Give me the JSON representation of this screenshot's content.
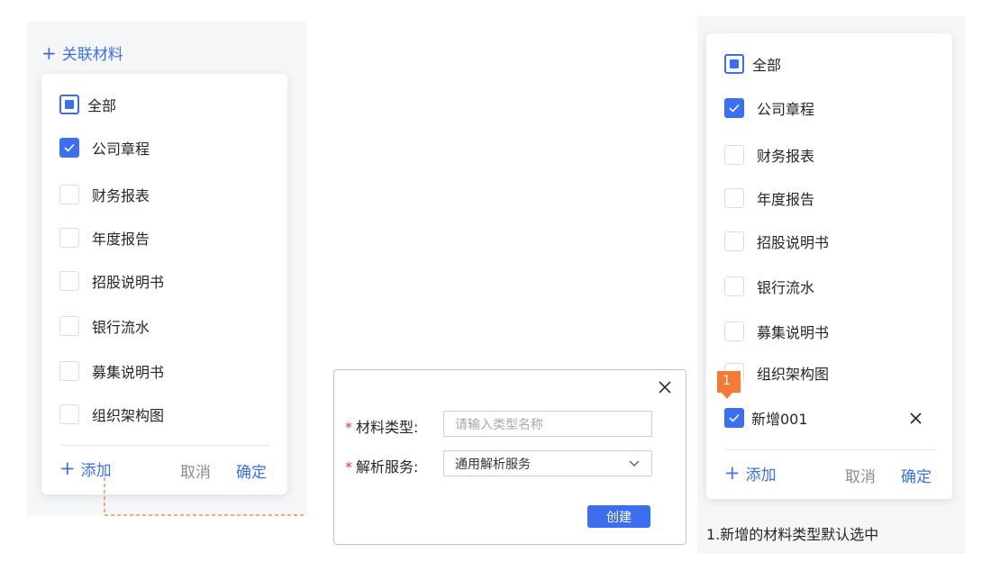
{
  "left_panel": {
    "header_label": "关联材料",
    "header_plus": "+",
    "items": [
      {
        "label": "全部",
        "state": "indeterminate"
      },
      {
        "label": "公司章程",
        "state": "checked"
      },
      {
        "label": "财务报表",
        "state": "unchecked"
      },
      {
        "label": "年度报告",
        "state": "unchecked"
      },
      {
        "label": "招股说明书",
        "state": "unchecked"
      },
      {
        "label": "银行流水",
        "state": "unchecked"
      },
      {
        "label": "募集说明书",
        "state": "unchecked"
      },
      {
        "label": "组织架构图",
        "state": "unchecked"
      }
    ],
    "add_plus": "+",
    "add_label": "添加",
    "cancel_label": "取消",
    "confirm_label": "确定"
  },
  "dialog": {
    "close_icon": "close-icon",
    "required_mark": "*",
    "type_label": "材料类型:",
    "type_placeholder": "请输入类型名称",
    "service_label": "解析服务:",
    "service_value": "通用解析服务",
    "create_label": "创建"
  },
  "right_panel": {
    "items": [
      {
        "label": "全部",
        "state": "indeterminate"
      },
      {
        "label": "公司章程",
        "state": "checked"
      },
      {
        "label": "财务报表",
        "state": "unchecked"
      },
      {
        "label": "年度报告",
        "state": "unchecked"
      },
      {
        "label": "招股说明书",
        "state": "unchecked"
      },
      {
        "label": "银行流水",
        "state": "unchecked"
      },
      {
        "label": "募集说明书",
        "state": "unchecked"
      },
      {
        "label": "组织架构图",
        "state": "unchecked"
      }
    ],
    "new_item_label": "新增001",
    "new_item_state": "checked",
    "badge_number": "1",
    "add_plus": "+",
    "add_label": "添加",
    "cancel_label": "取消",
    "confirm_label": "确定",
    "note": "1.新增的材料类型默认选中"
  },
  "colors": {
    "accent": "#3c6ff0",
    "badge": "#f37a37",
    "connector": "#f37a37",
    "required": "#e5393a"
  }
}
